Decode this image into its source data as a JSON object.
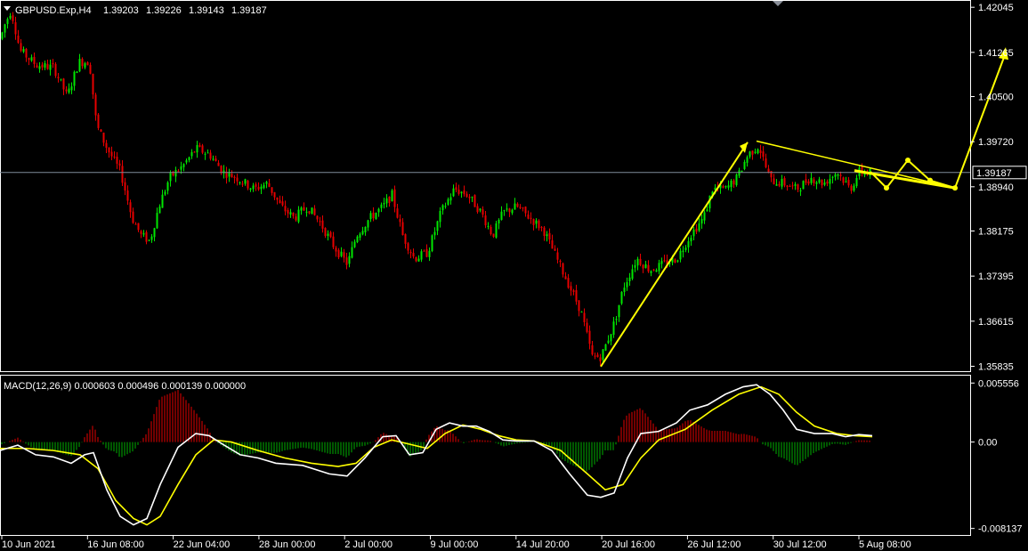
{
  "header": {
    "symbol_line": "GBPUSD.Exp,H4",
    "ohlc": [
      "1.39203",
      "1.39226",
      "1.39143",
      "1.39187"
    ]
  },
  "macd": {
    "label": "MACD(12,26,9) 0.000603 0.000496 0.000139 0.000000",
    "y_ticks": [
      "0.005556",
      "0.00",
      "-0.008137"
    ],
    "y_tick_values": [
      0.005556,
      0.0,
      -0.008137
    ]
  },
  "price_axis": {
    "ticks": [
      "1.42045",
      "1.41265",
      "1.40500",
      "1.39720",
      "1.38940",
      "1.38175",
      "1.37395",
      "1.36615",
      "1.35835"
    ],
    "tick_values": [
      1.42045,
      1.41265,
      1.405,
      1.3972,
      1.3894,
      1.38175,
      1.37395,
      1.36615,
      1.35835
    ],
    "current_price": "1.39187",
    "current_value": 1.39187
  },
  "time_axis": {
    "labels": [
      "10 Jun 2021",
      "16 Jun 08:00",
      "22 Jun 04:00",
      "28 Jun 00:00",
      "2 Jul 00:00",
      "9 Jul 00:00",
      "14 Jul 20:00",
      "20 Jul 16:00",
      "26 Jul 12:00",
      "30 Jul 12:00",
      "5 Aug 08:00"
    ]
  },
  "colors": {
    "background": "#000000",
    "bull_candle": "#00e600",
    "bear_candle": "#e60000",
    "frame": "#ffffff",
    "annotation": "#ffff00",
    "macd_line": "#ffffff",
    "signal_line": "#ffff00",
    "hist_pos": "#e60000",
    "hist_neg": "#00b000",
    "price_line": "#7f8c99"
  },
  "chart_data": [
    {
      "type": "candlestick",
      "title": "GBPUSD.Exp,H4",
      "y_range": [
        1.3575,
        1.4214
      ],
      "grid": false,
      "x_categories": [
        "10 Jun 2021",
        "16 Jun 08:00",
        "22 Jun 04:00",
        "28 Jun 00:00",
        "2 Jul 00:00",
        "9 Jul 00:00",
        "14 Jul 20:00",
        "20 Jul 16:00",
        "26 Jul 12:00",
        "30 Jul 12:00",
        "5 Aug 08:00"
      ],
      "close_path": [
        [
          0,
          1.415
        ],
        [
          5,
          1.4175
        ],
        [
          12,
          1.42
        ],
        [
          22,
          1.413
        ],
        [
          40,
          1.4105
        ],
        [
          60,
          1.41
        ],
        [
          75,
          1.405
        ],
        [
          88,
          1.411
        ],
        [
          100,
          1.411
        ],
        [
          108,
          1.4
        ],
        [
          120,
          1.396
        ],
        [
          135,
          1.392
        ],
        [
          148,
          1.384
        ],
        [
          158,
          1.381
        ],
        [
          168,
          1.38
        ],
        [
          178,
          1.386
        ],
        [
          190,
          1.391
        ],
        [
          205,
          1.393
        ],
        [
          220,
          1.396
        ],
        [
          235,
          1.395
        ],
        [
          250,
          1.392
        ],
        [
          265,
          1.391
        ],
        [
          285,
          1.389
        ],
        [
          300,
          1.39
        ],
        [
          315,
          1.386
        ],
        [
          330,
          1.384
        ],
        [
          345,
          1.386
        ],
        [
          360,
          1.383
        ],
        [
          375,
          1.379
        ],
        [
          390,
          1.376
        ],
        [
          400,
          1.381
        ],
        [
          415,
          1.384
        ],
        [
          430,
          1.386
        ],
        [
          440,
          1.388
        ],
        [
          452,
          1.381
        ],
        [
          465,
          1.377
        ],
        [
          480,
          1.378
        ],
        [
          495,
          1.385
        ],
        [
          510,
          1.389
        ],
        [
          525,
          1.388
        ],
        [
          540,
          1.385
        ],
        [
          553,
          1.381
        ],
        [
          565,
          1.385
        ],
        [
          580,
          1.386
        ],
        [
          595,
          1.384
        ],
        [
          610,
          1.382
        ],
        [
          625,
          1.377
        ],
        [
          640,
          1.372
        ],
        [
          652,
          1.368
        ],
        [
          665,
          1.36
        ],
        [
          675,
          1.36
        ],
        [
          690,
          1.366
        ],
        [
          700,
          1.372
        ],
        [
          715,
          1.377
        ],
        [
          730,
          1.375
        ],
        [
          745,
          1.376
        ],
        [
          760,
          1.377
        ],
        [
          775,
          1.381
        ],
        [
          790,
          1.384
        ],
        [
          800,
          1.389
        ],
        [
          815,
          1.389
        ],
        [
          828,
          1.391
        ],
        [
          840,
          1.395
        ],
        [
          852,
          1.3965
        ],
        [
          865,
          1.3905
        ],
        [
          880,
          1.39
        ],
        [
          895,
          1.389
        ],
        [
          910,
          1.391
        ],
        [
          925,
          1.39
        ],
        [
          940,
          1.392
        ],
        [
          955,
          1.389
        ],
        [
          965,
          1.392
        ],
        [
          978,
          1.3919
        ]
      ],
      "annotations": [
        {
          "type": "arrow",
          "from": [
            "20 Jul 16:00",
            1.3583
          ],
          "to": [
            "26 Jul 12:00",
            1.3971
          ]
        },
        {
          "type": "trendline",
          "from": [
            "26 Jul 12:00",
            1.3973
          ],
          "to": [
            "5 Aug 08:00",
            1.3892
          ]
        },
        {
          "type": "projected_path",
          "points": [
            [
              1.392
            ],
            [
              1.3892
            ],
            [
              1.392
            ],
            [
              1.3892
            ],
            [
              1.4126
            ]
          ]
        }
      ]
    },
    {
      "type": "macd",
      "title": "MACD(12,26,9)",
      "params": [
        12,
        26,
        9
      ],
      "values": {
        "macd": 0.000603,
        "signal": 0.000496,
        "histogram": 0.000139,
        "level": 0.0
      },
      "y_range": [
        -0.0085,
        0.006
      ],
      "macd_line": [
        [
          0,
          -0.0008
        ],
        [
          20,
          -0.0003
        ],
        [
          40,
          -0.0012
        ],
        [
          60,
          -0.0014
        ],
        [
          80,
          -0.002
        ],
        [
          95,
          -0.0012
        ],
        [
          105,
          -0.001
        ],
        [
          120,
          -0.0045
        ],
        [
          135,
          -0.007
        ],
        [
          150,
          -0.0078
        ],
        [
          165,
          -0.0072
        ],
        [
          180,
          -0.004
        ],
        [
          200,
          -0.0005
        ],
        [
          220,
          0.0008
        ],
        [
          235,
          0.0006
        ],
        [
          250,
          -0.0002
        ],
        [
          270,
          -0.0012
        ],
        [
          290,
          -0.0015
        ],
        [
          310,
          -0.002
        ],
        [
          340,
          -0.0022
        ],
        [
          370,
          -0.003
        ],
        [
          390,
          -0.0032
        ],
        [
          410,
          -0.0015
        ],
        [
          430,
          0.0005
        ],
        [
          445,
          0.0006
        ],
        [
          460,
          -0.0012
        ],
        [
          475,
          -0.001
        ],
        [
          490,
          0.0012
        ],
        [
          505,
          0.0018
        ],
        [
          520,
          0.0015
        ],
        [
          535,
          0.0015
        ],
        [
          550,
          0.001
        ],
        [
          565,
          0.0002
        ],
        [
          580,
          0.0001
        ],
        [
          600,
          0.0001
        ],
        [
          620,
          -0.0008
        ],
        [
          640,
          -0.003
        ],
        [
          660,
          -0.005
        ],
        [
          675,
          -0.0052
        ],
        [
          690,
          -0.0048
        ],
        [
          705,
          -0.0015
        ],
        [
          720,
          0.0008
        ],
        [
          740,
          0.001
        ],
        [
          760,
          0.0018
        ],
        [
          775,
          0.003
        ],
        [
          795,
          0.0035
        ],
        [
          815,
          0.0045
        ],
        [
          835,
          0.0052
        ],
        [
          850,
          0.0054
        ],
        [
          865,
          0.0045
        ],
        [
          880,
          0.003
        ],
        [
          895,
          0.0012
        ],
        [
          915,
          0.0008
        ],
        [
          935,
          0.0008
        ],
        [
          950,
          0.0005
        ],
        [
          965,
          0.0007
        ],
        [
          980,
          0.0006
        ]
      ],
      "signal_line": [
        [
          0,
          -0.0006
        ],
        [
          30,
          -0.0006
        ],
        [
          60,
          -0.0008
        ],
        [
          90,
          -0.0012
        ],
        [
          110,
          -0.0025
        ],
        [
          130,
          -0.0055
        ],
        [
          150,
          -0.0072
        ],
        [
          165,
          -0.0078
        ],
        [
          180,
          -0.007
        ],
        [
          200,
          -0.004
        ],
        [
          220,
          -0.0012
        ],
        [
          240,
          0.0002
        ],
        [
          260,
          0.0
        ],
        [
          290,
          -0.0008
        ],
        [
          320,
          -0.0015
        ],
        [
          350,
          -0.002
        ],
        [
          380,
          -0.0023
        ],
        [
          400,
          -0.002
        ],
        [
          420,
          -0.0005
        ],
        [
          440,
          0.0002
        ],
        [
          460,
          -0.0002
        ],
        [
          480,
          -0.0006
        ],
        [
          500,
          0.0008
        ],
        [
          520,
          0.0016
        ],
        [
          540,
          0.0012
        ],
        [
          560,
          0.0006
        ],
        [
          580,
          0.0002
        ],
        [
          600,
          0.0001
        ],
        [
          630,
          -0.0008
        ],
        [
          660,
          -0.003
        ],
        [
          680,
          -0.0045
        ],
        [
          700,
          -0.004
        ],
        [
          720,
          -0.0015
        ],
        [
          740,
          0.0002
        ],
        [
          770,
          0.0012
        ],
        [
          800,
          0.003
        ],
        [
          830,
          0.0045
        ],
        [
          855,
          0.0052
        ],
        [
          875,
          0.0045
        ],
        [
          895,
          0.0028
        ],
        [
          915,
          0.0015
        ],
        [
          940,
          0.0008
        ],
        [
          960,
          0.0006
        ],
        [
          980,
          0.0005
        ]
      ]
    }
  ]
}
